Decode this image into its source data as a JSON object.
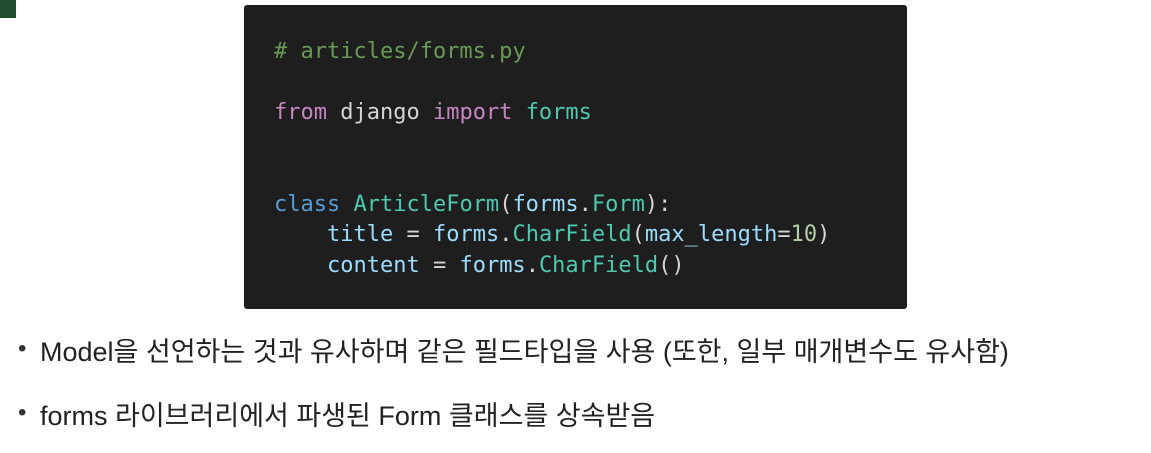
{
  "code": {
    "lines": [
      [
        {
          "t": "# articles/forms.py",
          "c": "comment"
        }
      ],
      [],
      [
        {
          "t": "from",
          "c": "keyword-ctrl"
        },
        {
          "t": " django ",
          "c": "plain"
        },
        {
          "t": "import",
          "c": "keyword-ctrl"
        },
        {
          "t": " ",
          "c": "plain"
        },
        {
          "t": "forms",
          "c": "class"
        }
      ],
      [],
      [],
      [
        {
          "t": "class",
          "c": "keyword"
        },
        {
          "t": " ",
          "c": "plain"
        },
        {
          "t": "ArticleForm",
          "c": "class"
        },
        {
          "t": "(",
          "c": "plain"
        },
        {
          "t": "forms",
          "c": "var"
        },
        {
          "t": ".",
          "c": "plain"
        },
        {
          "t": "Form",
          "c": "class"
        },
        {
          "t": "):",
          "c": "plain"
        }
      ],
      [
        {
          "t": "    ",
          "c": "plain"
        },
        {
          "t": "title",
          "c": "var"
        },
        {
          "t": " = ",
          "c": "op"
        },
        {
          "t": "forms",
          "c": "var"
        },
        {
          "t": ".",
          "c": "plain"
        },
        {
          "t": "CharField",
          "c": "class"
        },
        {
          "t": "(",
          "c": "plain"
        },
        {
          "t": "max_length",
          "c": "var"
        },
        {
          "t": "=",
          "c": "op"
        },
        {
          "t": "10",
          "c": "number"
        },
        {
          "t": ")",
          "c": "plain"
        }
      ],
      [
        {
          "t": "    ",
          "c": "plain"
        },
        {
          "t": "content",
          "c": "var"
        },
        {
          "t": " = ",
          "c": "op"
        },
        {
          "t": "forms",
          "c": "var"
        },
        {
          "t": ".",
          "c": "plain"
        },
        {
          "t": "CharField",
          "c": "class"
        },
        {
          "t": "()",
          "c": "plain"
        }
      ]
    ]
  },
  "bullets": [
    {
      "dot": "•",
      "text": "Model을 선언하는 것과 유사하며 같은 필드타입을 사용 (또한, 일부 매개변수도 유사함)"
    },
    {
      "dot": "•",
      "text": "forms 라이브러리에서 파생된 Form 클래스를 상속받음"
    }
  ],
  "colors": {
    "code_background": "#1e1e1e",
    "accent_bar": "#1f4d2e",
    "comment": "#6a9955",
    "keyword": "#569cd6",
    "keyword_control": "#c586c0",
    "class": "#4ec9b0",
    "variable": "#9cdcfe",
    "number": "#b5cea8"
  }
}
